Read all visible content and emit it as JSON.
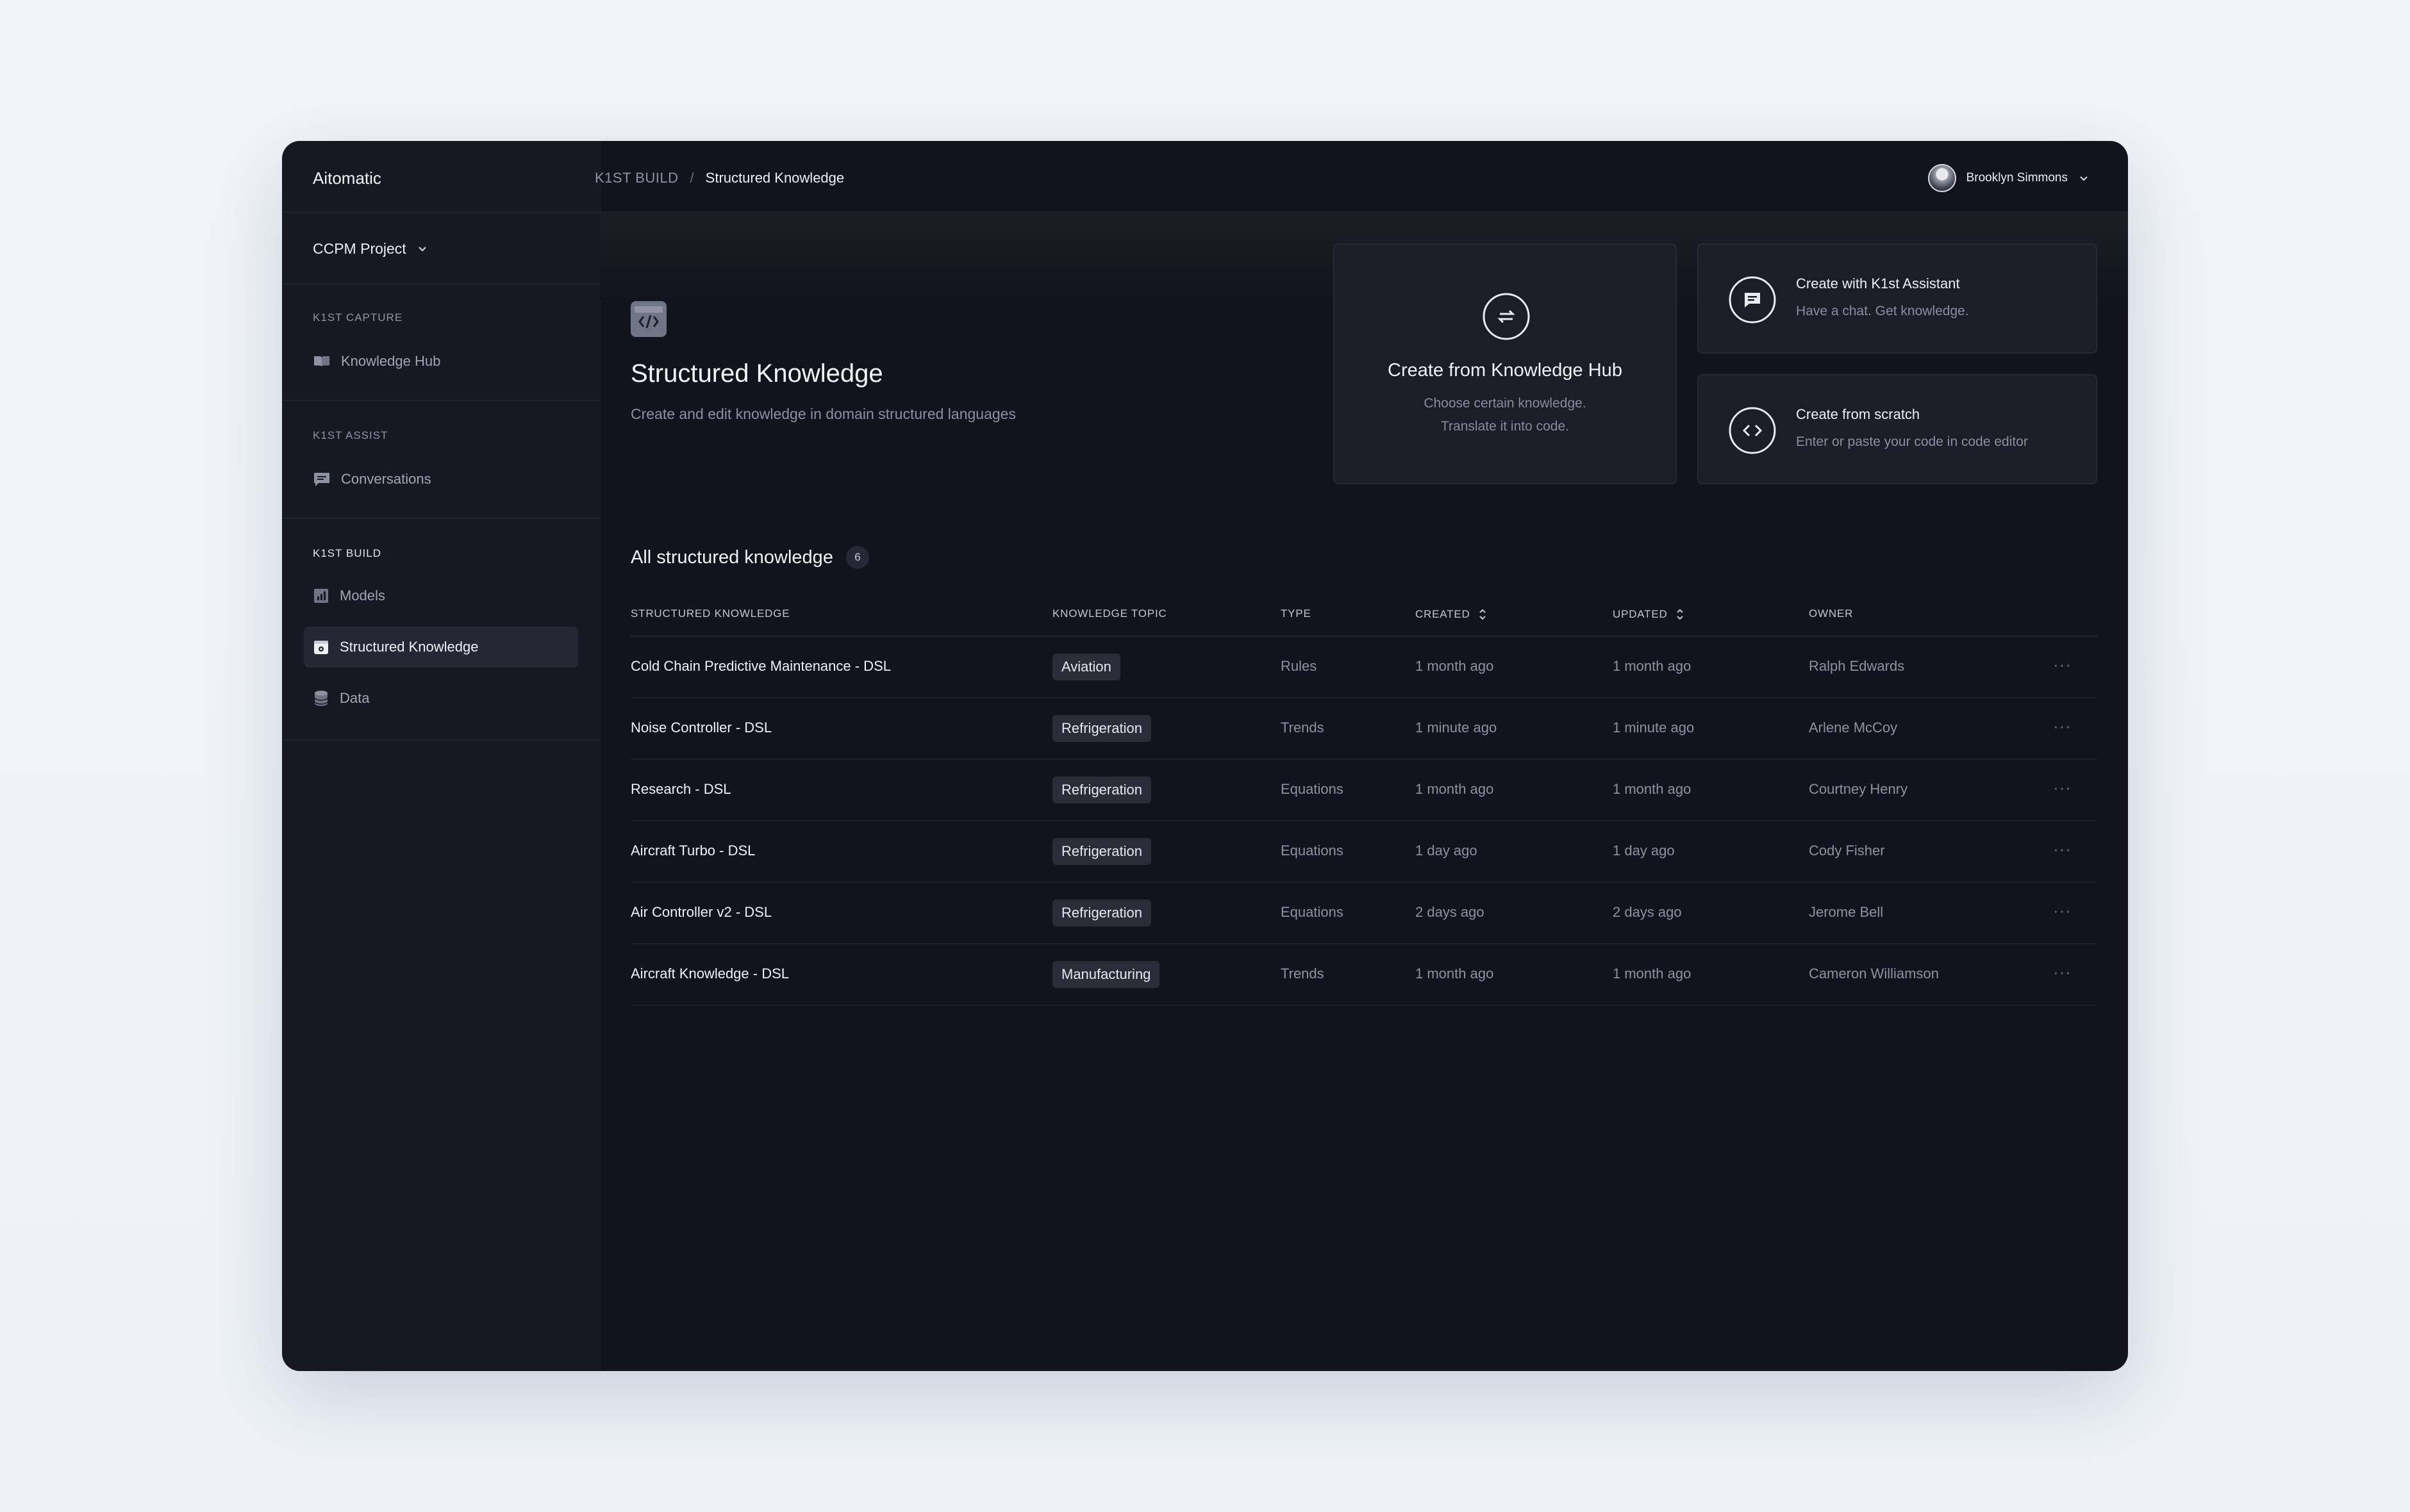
{
  "app": {
    "brand": "Aitomatic",
    "project": "CCPM Project"
  },
  "sidebar": {
    "sections": [
      {
        "label": "K1ST CAPTURE",
        "items": [
          {
            "label": "Knowledge Hub",
            "icon": "book-icon"
          }
        ]
      },
      {
        "label": "K1ST ASSIST",
        "items": [
          {
            "label": "Conversations",
            "icon": "chat-icon"
          }
        ]
      },
      {
        "label": "K1ST BUILD",
        "items": [
          {
            "label": "Models",
            "icon": "chart-icon"
          },
          {
            "label": "Structured Knowledge",
            "icon": "gear-doc-icon"
          },
          {
            "label": "Data",
            "icon": "database-icon"
          }
        ]
      }
    ],
    "active_item": "Structured Knowledge"
  },
  "breadcrumb": {
    "parent": "K1ST BUILD",
    "separator": "/",
    "current": "Structured Knowledge"
  },
  "user": {
    "name": "Brooklyn Simmons"
  },
  "page": {
    "title": "Structured Knowledge",
    "subtitle": "Create and edit knowledge in domain structured languages"
  },
  "cards": {
    "hub": {
      "title": "Create from Knowledge Hub",
      "line1": "Choose certain knowledge.",
      "line2": "Translate it into code."
    },
    "assistant": {
      "title": "Create with K1st Assistant",
      "desc": "Have a chat. Get knowledge."
    },
    "scratch": {
      "title": "Create from scratch",
      "desc": "Enter or paste your code in code editor"
    }
  },
  "list": {
    "title": "All structured knowledge",
    "count": "6",
    "columns": [
      "STRUCTURED KNOWLEDGE",
      "KNOWLEDGE TOPIC",
      "TYPE",
      "CREATED",
      "UPDATED",
      "OWNER"
    ],
    "rows": [
      {
        "name": "Cold Chain Predictive Maintenance - DSL",
        "topic": "Aviation",
        "type": "Rules",
        "created": "1 month ago",
        "updated": "1 month ago",
        "owner": "Ralph Edwards"
      },
      {
        "name": "Noise Controller - DSL",
        "topic": "Refrigeration",
        "type": "Trends",
        "created": "1 minute ago",
        "updated": "1 minute ago",
        "owner": "Arlene McCoy"
      },
      {
        "name": "Research - DSL",
        "topic": "Refrigeration",
        "type": "Equations",
        "created": "1 month ago",
        "updated": "1 month ago",
        "owner": "Courtney Henry"
      },
      {
        "name": "Aircraft Turbo - DSL",
        "topic": "Refrigeration",
        "type": "Equations",
        "created": "1 day ago",
        "updated": "1 day ago",
        "owner": "Cody Fisher"
      },
      {
        "name": "Air Controller v2 - DSL",
        "topic": "Refrigeration",
        "type": "Equations",
        "created": "2 days ago",
        "updated": "2 days ago",
        "owner": "Jerome Bell"
      },
      {
        "name": "Aircraft Knowledge - DSL",
        "topic": "Manufacturing",
        "type": "Trends",
        "created": "1 month ago",
        "updated": "1 month ago",
        "owner": "Cameron Williamson"
      }
    ],
    "row_menu": "···"
  },
  "colors": {
    "background": "#12131d",
    "sidebar": "#171822",
    "card": "#1b1d27",
    "tag": "#2a2c38"
  }
}
